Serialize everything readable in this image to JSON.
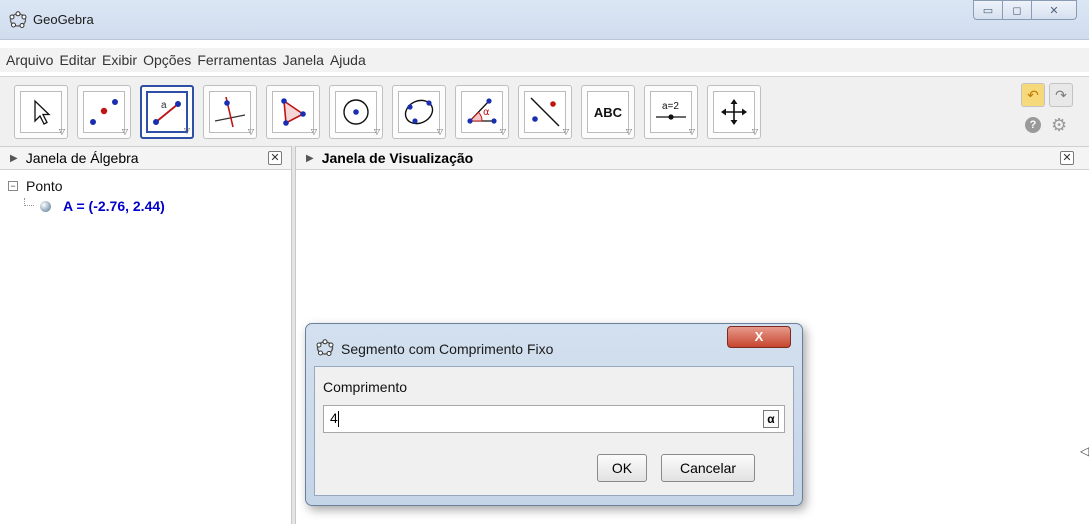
{
  "window": {
    "title": "GeoGebra",
    "controls": [
      "minimize",
      "maximize",
      "close"
    ]
  },
  "menu": {
    "items": [
      "Arquivo",
      "Editar",
      "Exibir",
      "Opções",
      "Ferramentas",
      "Janela",
      "Ajuda"
    ]
  },
  "toolbar": {
    "tools": [
      {
        "icon": "move-arrow-icon",
        "label": ""
      },
      {
        "icon": "point-icon",
        "label": ""
      },
      {
        "icon": "segment-fixed-length-icon",
        "label": "a",
        "selected": true
      },
      {
        "icon": "perpendicular-line-icon",
        "label": ""
      },
      {
        "icon": "polygon-icon",
        "label": ""
      },
      {
        "icon": "circle-center-point-icon",
        "label": ""
      },
      {
        "icon": "conic-five-points-icon",
        "label": ""
      },
      {
        "icon": "angle-icon",
        "label": "α"
      },
      {
        "icon": "reflect-line-icon",
        "label": ""
      },
      {
        "icon": "text-icon",
        "label": "ABC"
      },
      {
        "icon": "slider-icon",
        "label": "a=2"
      },
      {
        "icon": "move-graphics-icon",
        "label": ""
      }
    ],
    "undo_icon": "undo-icon",
    "redo_icon": "redo-icon",
    "help_icon": "help-icon",
    "settings_icon": "gear-icon"
  },
  "algebra": {
    "header": "Janela de Álgebra",
    "group": "Ponto",
    "objects": [
      "A = (-2.76, 2.44)"
    ]
  },
  "graphics": {
    "header": "Janela de Visualização"
  },
  "dialog": {
    "title": "Segmento com Comprimento Fixo",
    "close": "X",
    "label": "Comprimento",
    "input_value": "4",
    "alpha_button": "α",
    "ok": "OK",
    "cancel": "Cancelar"
  },
  "colors": {
    "algebra_object": "#0000cc",
    "selected_tool_border": "#2f4fa7",
    "dialog_close": "#c6462f"
  }
}
